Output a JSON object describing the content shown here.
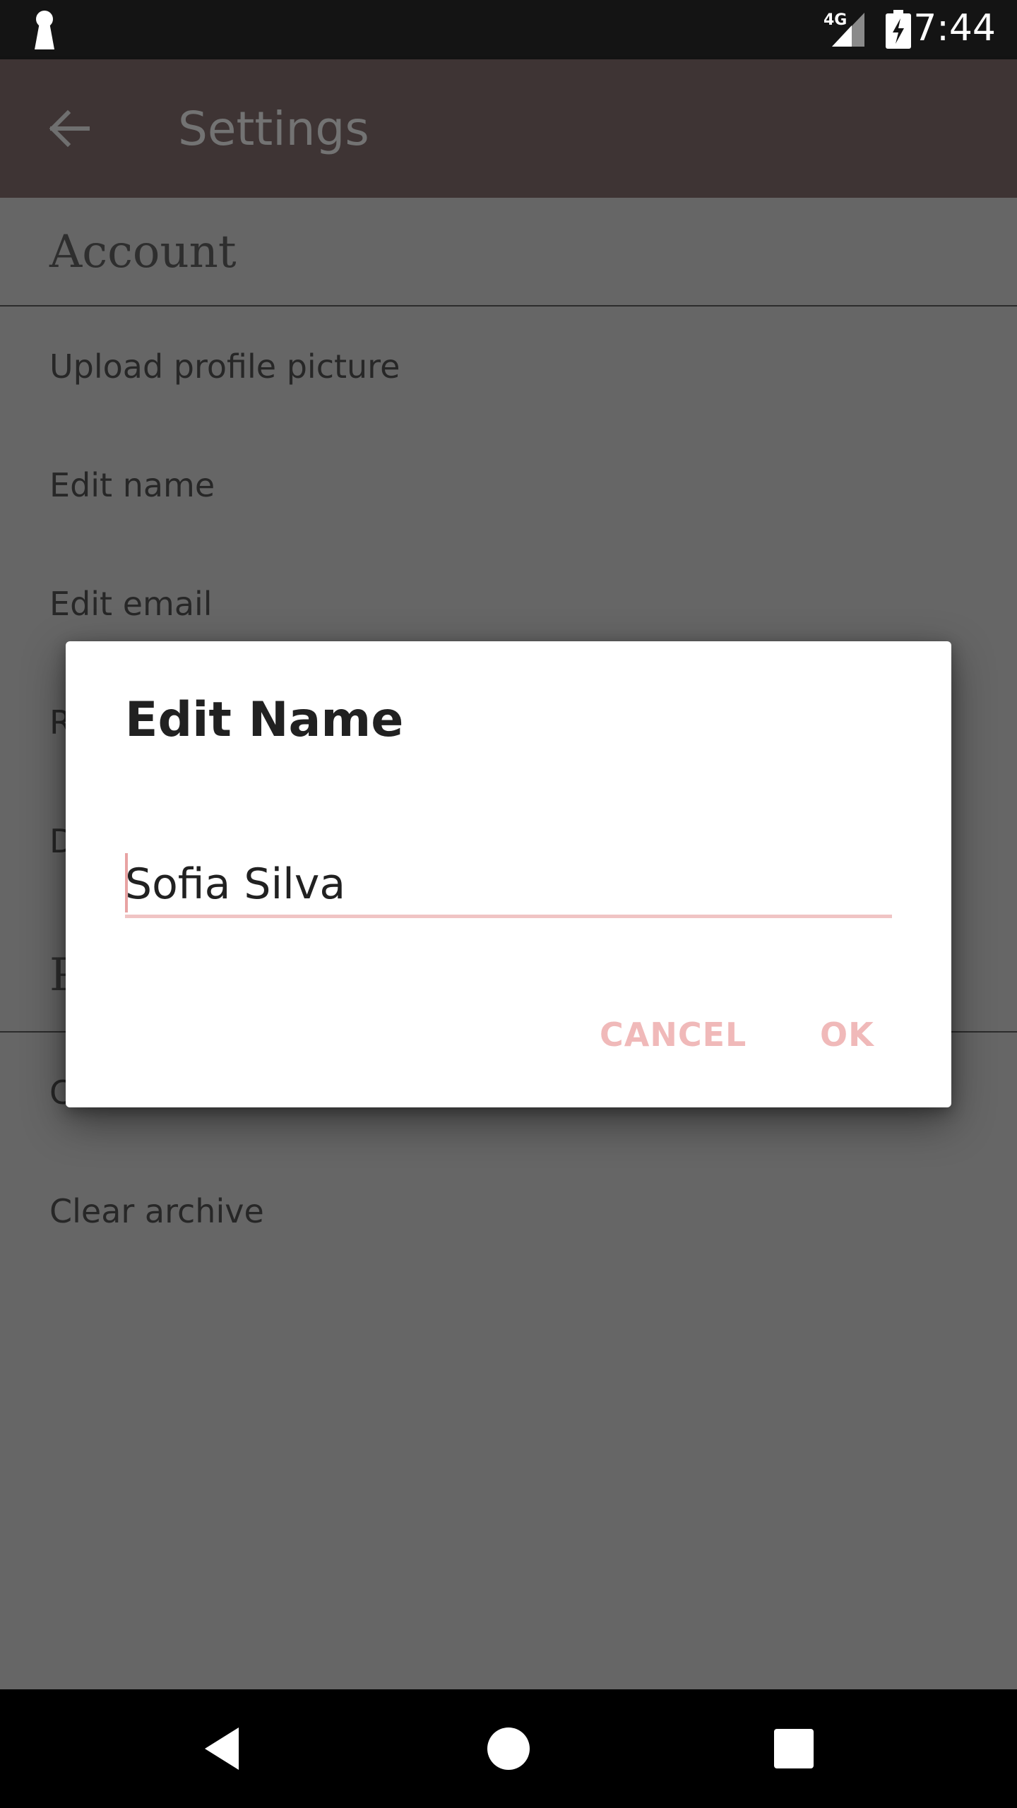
{
  "status_bar": {
    "network": "4G",
    "time": "7:44"
  },
  "app_bar": {
    "title": "Settings"
  },
  "sections": [
    {
      "header": "Account",
      "items": [
        "Upload profile picture",
        "Edit name",
        "Edit email",
        "R",
        "D"
      ]
    },
    {
      "header": "P",
      "items": [
        "C",
        "Clear archive"
      ]
    }
  ],
  "dialog": {
    "title": "Edit Name",
    "name_value": "Sofia Silva",
    "cancel_label": "CANCEL",
    "ok_label": "OK"
  },
  "colors": {
    "status_bar": "#141414",
    "app_bar": "#3e3434",
    "scrim_background": "#666666",
    "accent": "#f0b9b9",
    "nav_bar": "#000000"
  },
  "icons": {
    "status_left": "keyhole-icon",
    "signal": "signal-icon",
    "battery": "battery-charging-icon",
    "back": "arrow-back-icon",
    "nav_back": "nav-back-icon",
    "nav_home": "nav-home-icon",
    "nav_recents": "nav-recents-icon"
  }
}
